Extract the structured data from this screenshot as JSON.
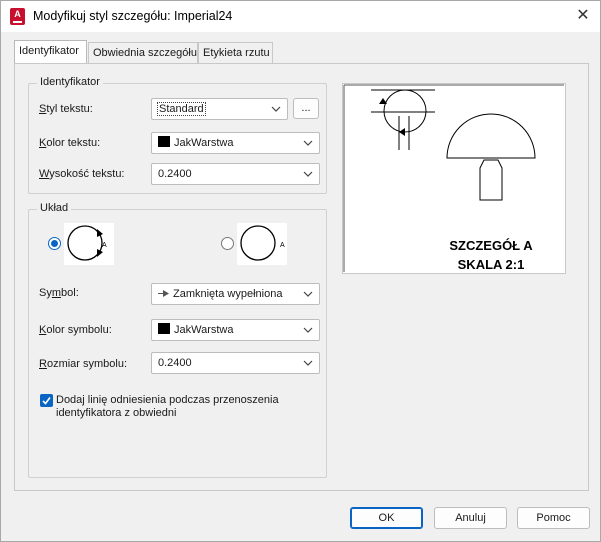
{
  "window": {
    "title": "Modyfikuj styl szczegółu: Imperial24",
    "app_icon_letter": "A"
  },
  "tabs": [
    {
      "label": "Identyfikator",
      "active": true
    },
    {
      "label": "Obwiednia szczegółu",
      "active": false
    },
    {
      "label": "Etykieta rzutu",
      "active": false
    }
  ],
  "identyfikator_group": {
    "title": "Identyfikator",
    "styl_tekstu": {
      "label": "Styl tekstu:",
      "value": "Standard",
      "browse_label": "..."
    },
    "kolor_tekstu": {
      "label": "Kolor tekstu:",
      "value": "JakWarstwa",
      "swatch_color": "#000000"
    },
    "wysokosc_tekstu": {
      "label": "Wysokość tekstu:",
      "value": "0.2400"
    }
  },
  "uklad_group": {
    "title": "Układ",
    "layout_options": [
      {
        "selected": true,
        "letter": "A"
      },
      {
        "selected": false,
        "letter": "A"
      }
    ],
    "symbol": {
      "label": "Symbol:",
      "value": "Zamknięta wypełniona"
    },
    "kolor_symbolu": {
      "label": "Kolor symbolu:",
      "value": "JakWarstwa",
      "swatch_color": "#000000"
    },
    "rozmiar_symbolu": {
      "label": "Rozmiar symbolu:",
      "value": "0.2400"
    },
    "checkbox": {
      "checked": true,
      "line1": "Dodaj linię odniesienia podczas przenoszenia",
      "line2": "identyfikatora z obwiedni"
    }
  },
  "preview": {
    "caption_line1": "SZCZEGÓŁ A",
    "caption_line2": "SKALA 2:1"
  },
  "footer": {
    "ok": "OK",
    "cancel": "Anuluj",
    "help": "Pomoc"
  },
  "colors": {
    "accent": "#0a64c4",
    "app_icon": "#c8102e"
  }
}
